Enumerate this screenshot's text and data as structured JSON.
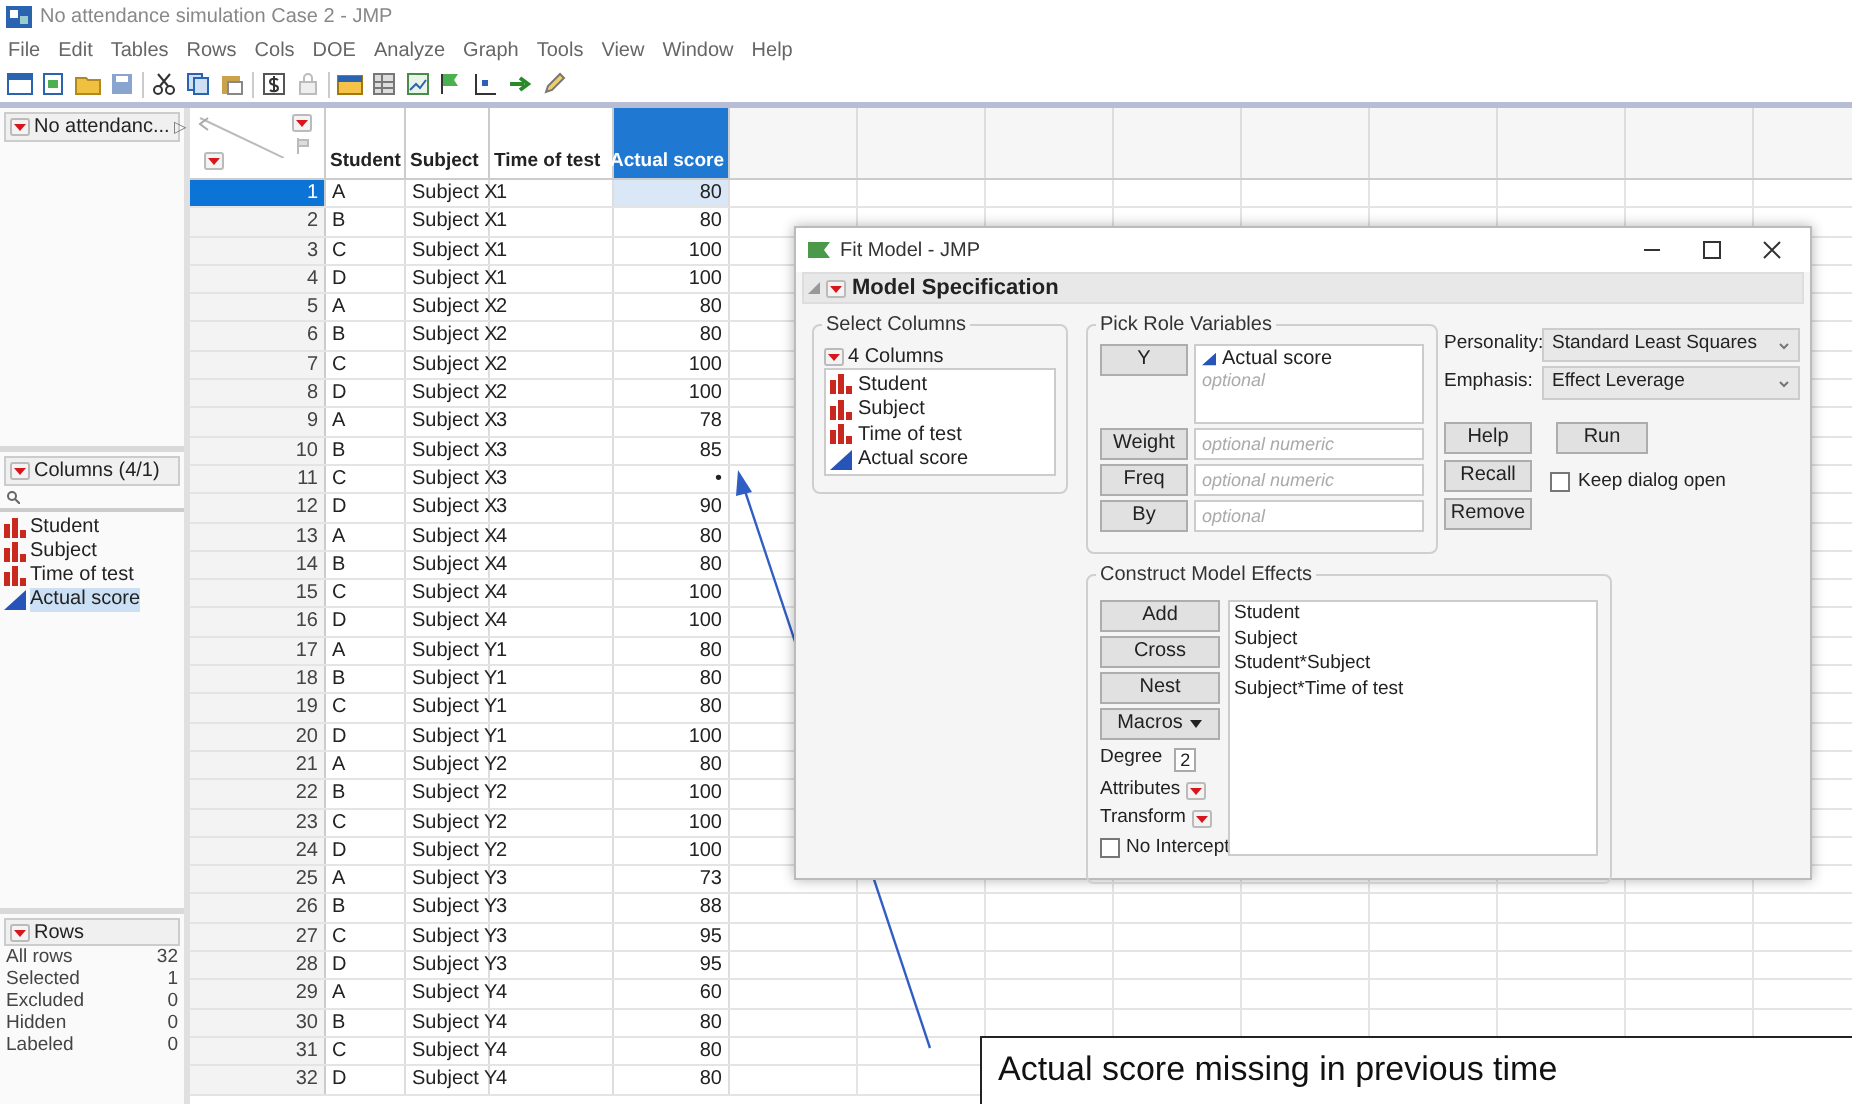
{
  "window": {
    "title": "No attendance simulation Case 2 - JMP"
  },
  "menu": [
    "File",
    "Edit",
    "Tables",
    "Rows",
    "Cols",
    "DOE",
    "Analyze",
    "Graph",
    "Tools",
    "View",
    "Window",
    "Help"
  ],
  "table_panel": {
    "title": "No attendanc...",
    "expander": "▷"
  },
  "columns_panel": {
    "title": "Columns (4/1)",
    "items": [
      {
        "label": "Student",
        "kind": "nominal",
        "selected": false
      },
      {
        "label": "Subject",
        "kind": "nominal",
        "selected": false
      },
      {
        "label": "Time of test",
        "kind": "nominal",
        "selected": false
      },
      {
        "label": "Actual score",
        "kind": "continuous",
        "selected": true
      }
    ]
  },
  "rows_panel": {
    "title": "Rows",
    "stats": [
      {
        "label": "All rows",
        "value": "32"
      },
      {
        "label": "Selected",
        "value": "1"
      },
      {
        "label": "Excluded",
        "value": "0"
      },
      {
        "label": "Hidden",
        "value": "0"
      },
      {
        "label": "Labeled",
        "value": "0"
      }
    ]
  },
  "table": {
    "columns": [
      {
        "label": "Student",
        "kind": "character",
        "selected": false
      },
      {
        "label": "Subject",
        "kind": "character",
        "selected": false
      },
      {
        "label": "Time of test",
        "kind": "character",
        "selected": false
      },
      {
        "label": "Actual score",
        "kind": "numeric",
        "selected": true
      }
    ],
    "rows": [
      {
        "number": "1",
        "cells": [
          "A",
          "Subject X",
          "1",
          "80"
        ],
        "selected": true
      },
      {
        "number": "2",
        "cells": [
          "B",
          "Subject X",
          "1",
          "80"
        ],
        "selected": false
      },
      {
        "number": "3",
        "cells": [
          "C",
          "Subject X",
          "1",
          "100"
        ],
        "selected": false
      },
      {
        "number": "4",
        "cells": [
          "D",
          "Subject X",
          "1",
          "100"
        ],
        "selected": false
      },
      {
        "number": "5",
        "cells": [
          "A",
          "Subject X",
          "2",
          "80"
        ],
        "selected": false
      },
      {
        "number": "6",
        "cells": [
          "B",
          "Subject X",
          "2",
          "80"
        ],
        "selected": false
      },
      {
        "number": "7",
        "cells": [
          "C",
          "Subject X",
          "2",
          "100"
        ],
        "selected": false
      },
      {
        "number": "8",
        "cells": [
          "D",
          "Subject X",
          "2",
          "100"
        ],
        "selected": false
      },
      {
        "number": "9",
        "cells": [
          "A",
          "Subject X",
          "3",
          "78"
        ],
        "selected": false
      },
      {
        "number": "10",
        "cells": [
          "B",
          "Subject X",
          "3",
          "85"
        ],
        "selected": false
      },
      {
        "number": "11",
        "cells": [
          "C",
          "Subject X",
          "3",
          "•"
        ],
        "selected": false
      },
      {
        "number": "12",
        "cells": [
          "D",
          "Subject X",
          "3",
          "90"
        ],
        "selected": false
      },
      {
        "number": "13",
        "cells": [
          "A",
          "Subject X",
          "4",
          "80"
        ],
        "selected": false
      },
      {
        "number": "14",
        "cells": [
          "B",
          "Subject X",
          "4",
          "80"
        ],
        "selected": false
      },
      {
        "number": "15",
        "cells": [
          "C",
          "Subject X",
          "4",
          "100"
        ],
        "selected": false
      },
      {
        "number": "16",
        "cells": [
          "D",
          "Subject X",
          "4",
          "100"
        ],
        "selected": false
      },
      {
        "number": "17",
        "cells": [
          "A",
          "Subject Y",
          "1",
          "80"
        ],
        "selected": false
      },
      {
        "number": "18",
        "cells": [
          "B",
          "Subject Y",
          "1",
          "80"
        ],
        "selected": false
      },
      {
        "number": "19",
        "cells": [
          "C",
          "Subject Y",
          "1",
          "80"
        ],
        "selected": false
      },
      {
        "number": "20",
        "cells": [
          "D",
          "Subject Y",
          "1",
          "100"
        ],
        "selected": false
      },
      {
        "number": "21",
        "cells": [
          "A",
          "Subject Y",
          "2",
          "80"
        ],
        "selected": false
      },
      {
        "number": "22",
        "cells": [
          "B",
          "Subject Y",
          "2",
          "100"
        ],
        "selected": false
      },
      {
        "number": "23",
        "cells": [
          "C",
          "Subject Y",
          "2",
          "100"
        ],
        "selected": false
      },
      {
        "number": "24",
        "cells": [
          "D",
          "Subject Y",
          "2",
          "100"
        ],
        "selected": false
      },
      {
        "number": "25",
        "cells": [
          "A",
          "Subject Y",
          "3",
          "73"
        ],
        "selected": false
      },
      {
        "number": "26",
        "cells": [
          "B",
          "Subject Y",
          "3",
          "88"
        ],
        "selected": false
      },
      {
        "number": "27",
        "cells": [
          "C",
          "Subject Y",
          "3",
          "95"
        ],
        "selected": false
      },
      {
        "number": "28",
        "cells": [
          "D",
          "Subject Y",
          "3",
          "95"
        ],
        "selected": false
      },
      {
        "number": "29",
        "cells": [
          "A",
          "Subject Y",
          "4",
          "60"
        ],
        "selected": false
      },
      {
        "number": "30",
        "cells": [
          "B",
          "Subject Y",
          "4",
          "80"
        ],
        "selected": false
      },
      {
        "number": "31",
        "cells": [
          "C",
          "Subject Y",
          "4",
          "80"
        ],
        "selected": false
      },
      {
        "number": "32",
        "cells": [
          "D",
          "Subject Y",
          "4",
          "80"
        ],
        "selected": false
      }
    ]
  },
  "dialog": {
    "title": "Fit Model - JMP",
    "section_title": "Model Specification",
    "select_columns": {
      "title": "Select Columns",
      "count_label": "4 Columns",
      "items": [
        {
          "label": "Student",
          "kind": "nominal"
        },
        {
          "label": "Subject",
          "kind": "nominal"
        },
        {
          "label": "Time of test",
          "kind": "nominal"
        },
        {
          "label": "Actual score",
          "kind": "continuous"
        }
      ]
    },
    "pick_roles": {
      "title": "Pick Role Variables",
      "roles": [
        {
          "button": "Y",
          "kind": "list",
          "items": [
            "Actual score"
          ],
          "placeholder": "optional"
        },
        {
          "button": "Weight",
          "kind": "single",
          "placeholder": "optional numeric"
        },
        {
          "button": "Freq",
          "kind": "single",
          "placeholder": "optional numeric"
        },
        {
          "button": "By",
          "kind": "single",
          "placeholder": "optional"
        }
      ]
    },
    "personality": {
      "label": "Personality:",
      "value": "Standard Least Squares"
    },
    "emphasis": {
      "label": "Emphasis:",
      "value": "Effect Leverage"
    },
    "buttons": {
      "help": "Help",
      "run": "Run",
      "recall": "Recall",
      "remove": "Remove"
    },
    "keep_open": {
      "label": "Keep dialog open",
      "checked": false
    },
    "effects": {
      "title": "Construct Model Effects",
      "buttons": [
        "Add",
        "Cross",
        "Nest"
      ],
      "macros": "Macros",
      "degree": {
        "label": "Degree",
        "value": "2"
      },
      "attributes": "Attributes",
      "transform": "Transform",
      "no_intercept": {
        "label": "No Intercept",
        "checked": false
      },
      "items": [
        "Student",
        "Subject",
        "Student*Subject",
        "Subject*Time of test"
      ]
    }
  },
  "annotation": {
    "text": "Actual score missing in previous time"
  }
}
